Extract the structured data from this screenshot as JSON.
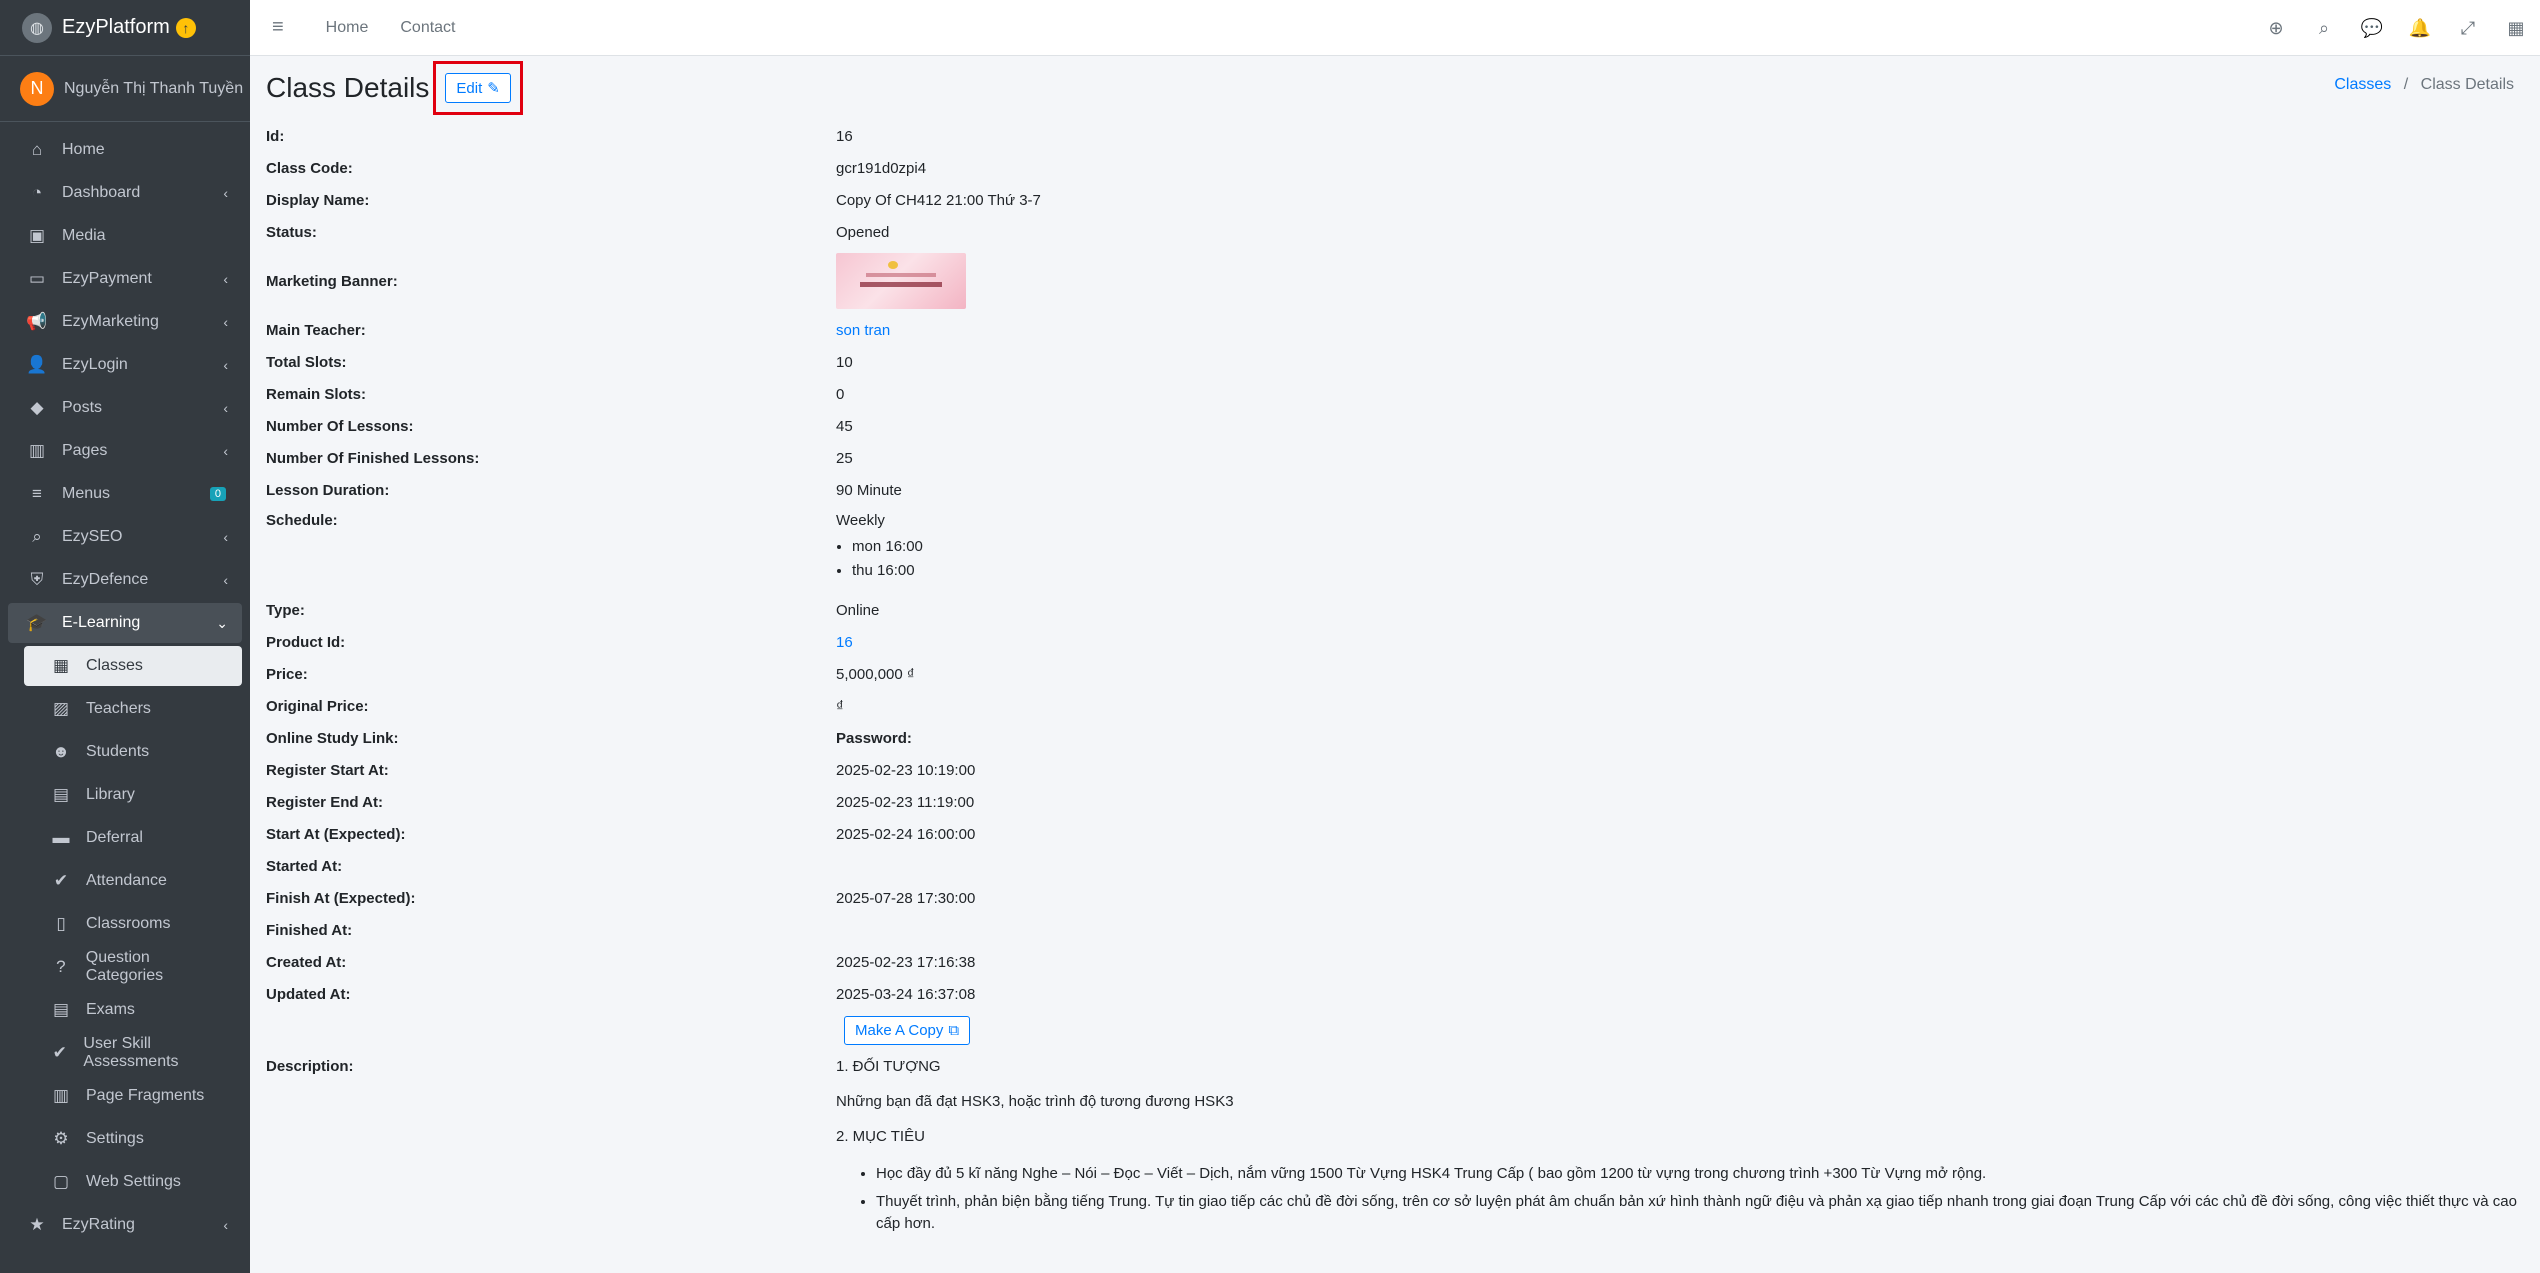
{
  "brand": {
    "name": "EzyPlatform"
  },
  "user": {
    "initial": "N",
    "name": "Nguyễn Thị Thanh Tuyền"
  },
  "sidebar": {
    "items": [
      {
        "label": "Home",
        "icon": "home-icon",
        "glyph": "⌂"
      },
      {
        "label": "Dashboard",
        "icon": "dashboard-icon",
        "glyph": "◔",
        "chevron": "‹"
      },
      {
        "label": "Media",
        "icon": "image-icon",
        "glyph": "▣"
      },
      {
        "label": "EzyPayment",
        "icon": "credit-card-icon",
        "glyph": "▭",
        "chevron": "‹"
      },
      {
        "label": "EzyMarketing",
        "icon": "megaphone-icon",
        "glyph": "📢",
        "chevron": "‹"
      },
      {
        "label": "EzyLogin",
        "icon": "user-lock-icon",
        "glyph": "👤",
        "chevron": "‹"
      },
      {
        "label": "Posts",
        "icon": "tag-icon",
        "glyph": "◆",
        "chevron": "‹"
      },
      {
        "label": "Pages",
        "icon": "columns-icon",
        "glyph": "▥",
        "chevron": "‹"
      },
      {
        "label": "Menus",
        "icon": "bars-icon",
        "glyph": "≡",
        "count": "0"
      },
      {
        "label": "EzySEO",
        "icon": "search-seo-icon",
        "glyph": "⌕",
        "chevron": "‹"
      },
      {
        "label": "EzyDefence",
        "icon": "shield-icon",
        "glyph": "⛨",
        "chevron": "‹"
      },
      {
        "label": "E-Learning",
        "icon": "graduation-cap-icon",
        "glyph": "🎓",
        "chevron": "⌄"
      }
    ],
    "sub_items": [
      {
        "label": "Classes",
        "icon": "grid-icon",
        "glyph": "▦"
      },
      {
        "label": "Teachers",
        "icon": "chalkboard-teacher-icon",
        "glyph": "▨"
      },
      {
        "label": "Students",
        "icon": "user-graduate-icon",
        "glyph": "☻"
      },
      {
        "label": "Library",
        "icon": "library-icon",
        "glyph": "▤"
      },
      {
        "label": "Deferral",
        "icon": "archive-icon",
        "glyph": "▬"
      },
      {
        "label": "Attendance",
        "icon": "user-check-icon",
        "glyph": "✔"
      },
      {
        "label": "Classrooms",
        "icon": "building-icon",
        "glyph": "▯"
      },
      {
        "label": "Question Categories",
        "icon": "question-icon",
        "glyph": "?"
      },
      {
        "label": "Exams",
        "icon": "exam-icon",
        "glyph": "▤"
      },
      {
        "label": "User Skill Assessments",
        "icon": "check-double-icon",
        "glyph": "✔"
      },
      {
        "label": "Page Fragments",
        "icon": "columns-icon",
        "glyph": "▥"
      },
      {
        "label": "Settings",
        "icon": "gears-icon",
        "glyph": "⚙"
      },
      {
        "label": "Web Settings",
        "icon": "window-icon",
        "glyph": "▢"
      }
    ],
    "after": [
      {
        "label": "EzyRating",
        "icon": "star-icon",
        "glyph": "★",
        "chevron": "‹"
      }
    ]
  },
  "topbar": {
    "menu_glyph": "≡",
    "links": [
      "Home",
      "Contact"
    ],
    "icons": [
      {
        "name": "globe-icon",
        "glyph": "⊕"
      },
      {
        "name": "search-icon",
        "glyph": "⌕"
      },
      {
        "name": "comments-icon",
        "glyph": "💬"
      },
      {
        "name": "bell-icon",
        "glyph": "🔔"
      },
      {
        "name": "fullscreen-icon",
        "glyph": "⤢"
      },
      {
        "name": "apps-grid-icon",
        "glyph": "▦"
      }
    ]
  },
  "page": {
    "title": "Class Details",
    "edit_label": "Edit",
    "edit_glyph": "✎",
    "breadcrumb": {
      "link": "Classes",
      "sep": "/",
      "current": "Class Details"
    }
  },
  "details": {
    "id": {
      "label": "Id:",
      "value": "16"
    },
    "class_code": {
      "label": "Class Code:",
      "value": "gcr191d0zpi4"
    },
    "display_name": {
      "label": "Display Name:",
      "value": "Copy Of CH412 21:00 Thứ 3-7"
    },
    "status": {
      "label": "Status:",
      "value": "Opened"
    },
    "marketing_banner": {
      "label": "Marketing Banner:"
    },
    "main_teacher": {
      "label": "Main Teacher:",
      "value": "son tran"
    },
    "total_slots": {
      "label": "Total Slots:",
      "value": "10"
    },
    "remain_slots": {
      "label": "Remain Slots:",
      "value": "0"
    },
    "number_of_lessons": {
      "label": "Number Of Lessons:",
      "value": "45"
    },
    "finished_lessons": {
      "label": "Number Of Finished Lessons:",
      "value": "25"
    },
    "lesson_duration": {
      "label": "Lesson Duration:",
      "value": "90 Minute"
    },
    "schedule": {
      "label": "Schedule:",
      "value": "Weekly",
      "items": [
        "mon 16:00",
        "thu 16:00"
      ]
    },
    "type": {
      "label": "Type:",
      "value": "Online"
    },
    "product_id": {
      "label": "Product Id:",
      "value": "16"
    },
    "price": {
      "label": "Price:",
      "value": "5,000,000 ₫"
    },
    "original_price": {
      "label": "Original Price:",
      "value": "₫"
    },
    "online_study_link": {
      "label": "Online Study Link:",
      "value": "Password:"
    },
    "register_start_at": {
      "label": "Register Start At:",
      "value": "2025-02-23 10:19:00"
    },
    "register_end_at": {
      "label": "Register End At:",
      "value": "2025-02-23 11:19:00"
    },
    "start_at_expected": {
      "label": "Start At (Expected):",
      "value": "2025-02-24 16:00:00"
    },
    "started_at": {
      "label": "Started At:",
      "value": ""
    },
    "finish_at_expected": {
      "label": "Finish At (Expected):",
      "value": "2025-07-28 17:30:00"
    },
    "finished_at": {
      "label": "Finished At:",
      "value": ""
    },
    "created_at": {
      "label": "Created At:",
      "value": "2025-02-23 17:16:38"
    },
    "updated_at": {
      "label": "Updated At:",
      "value": "2025-03-24 16:37:08"
    },
    "copy_button": {
      "label": "Make A Copy",
      "glyph": "⧉"
    },
    "description": {
      "label": "Description:",
      "h1": "1. ĐỐI TƯỢNG",
      "p1": "Những bạn đã đạt HSK3, hoặc trình độ tương đương HSK3",
      "h2": "2. MỤC TIÊU",
      "bullets": [
        "Học đầy đủ 5 kĩ năng Nghe – Nói – Đọc – Viết – Dịch, nắm vững 1500 Từ Vựng HSK4 Trung Cấp ( bao gồm 1200 từ vựng trong chương trình +300 Từ Vựng mở rộng.",
        "Thuyết trình, phản biện bằng tiếng Trung. Tự tin giao tiếp các chủ đề đời sống, trên cơ sở luyện phát âm chuẩn bản xứ hình thành ngữ điệu và phản xạ giao tiếp nhanh trong giai đoạn Trung Cấp với các chủ đề đời sống, công việc thiết thực và cao cấp hơn."
      ]
    }
  }
}
